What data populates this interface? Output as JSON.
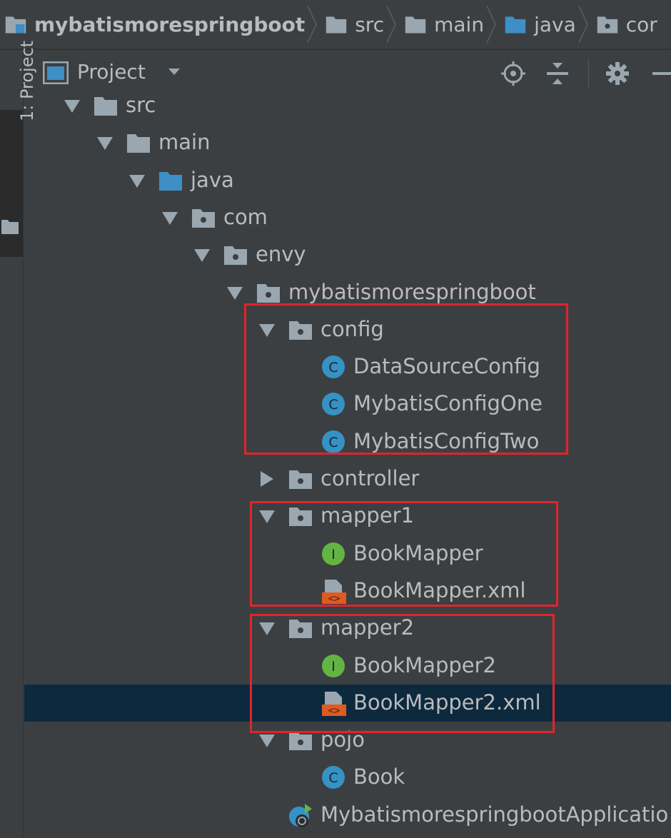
{
  "breadcrumb": [
    {
      "label": "mybatismorespringboot",
      "icon": "module-folder-icon"
    },
    {
      "label": "src",
      "icon": "folder-icon"
    },
    {
      "label": "main",
      "icon": "folder-icon"
    },
    {
      "label": "java",
      "icon": "source-folder-icon"
    },
    {
      "label": "cor",
      "icon": "package-icon"
    }
  ],
  "tool_window": {
    "tab_label": "1: Project"
  },
  "panel": {
    "title": "Project",
    "actions": [
      "locate-icon",
      "collapse-all-icon",
      "gear-icon",
      "minimize-icon"
    ]
  },
  "tree": [
    {
      "label": "src",
      "expanded": true,
      "icon": "folder-icon"
    },
    {
      "label": "main",
      "expanded": true,
      "icon": "folder-icon"
    },
    {
      "label": "java",
      "expanded": true,
      "icon": "source-folder-icon"
    },
    {
      "label": "com",
      "expanded": true,
      "icon": "package-icon"
    },
    {
      "label": "envy",
      "expanded": true,
      "icon": "package-icon"
    },
    {
      "label": "mybatismorespringboot",
      "expanded": true,
      "icon": "package-icon"
    },
    {
      "label": "config",
      "expanded": true,
      "icon": "package-icon"
    },
    {
      "label": "DataSourceConfig",
      "icon": "class-icon",
      "badge": "C"
    },
    {
      "label": "MybatisConfigOne",
      "icon": "class-icon",
      "badge": "C"
    },
    {
      "label": "MybatisConfigTwo",
      "icon": "class-icon",
      "badge": "C"
    },
    {
      "label": "controller",
      "expanded": false,
      "icon": "package-icon"
    },
    {
      "label": "mapper1",
      "expanded": true,
      "icon": "package-icon"
    },
    {
      "label": "BookMapper",
      "icon": "interface-icon",
      "badge": "I"
    },
    {
      "label": "BookMapper.xml",
      "icon": "xml-file-icon"
    },
    {
      "label": "mapper2",
      "expanded": true,
      "icon": "package-icon"
    },
    {
      "label": "BookMapper2",
      "icon": "interface-icon",
      "badge": "I"
    },
    {
      "label": "BookMapper2.xml",
      "icon": "xml-file-icon",
      "selected": true
    },
    {
      "label": "pojo",
      "expanded": true,
      "icon": "package-icon"
    },
    {
      "label": "Book",
      "icon": "class-icon",
      "badge": "C"
    },
    {
      "label": "MybatismorespringbootApplicatio",
      "icon": "spring-boot-app-icon"
    }
  ],
  "colors": {
    "highlight_box": "#e0242b",
    "selection": "#0d293e",
    "class_badge": "#3592c4",
    "interface_badge": "#62b543",
    "xml_badge": "#e05a1f"
  }
}
